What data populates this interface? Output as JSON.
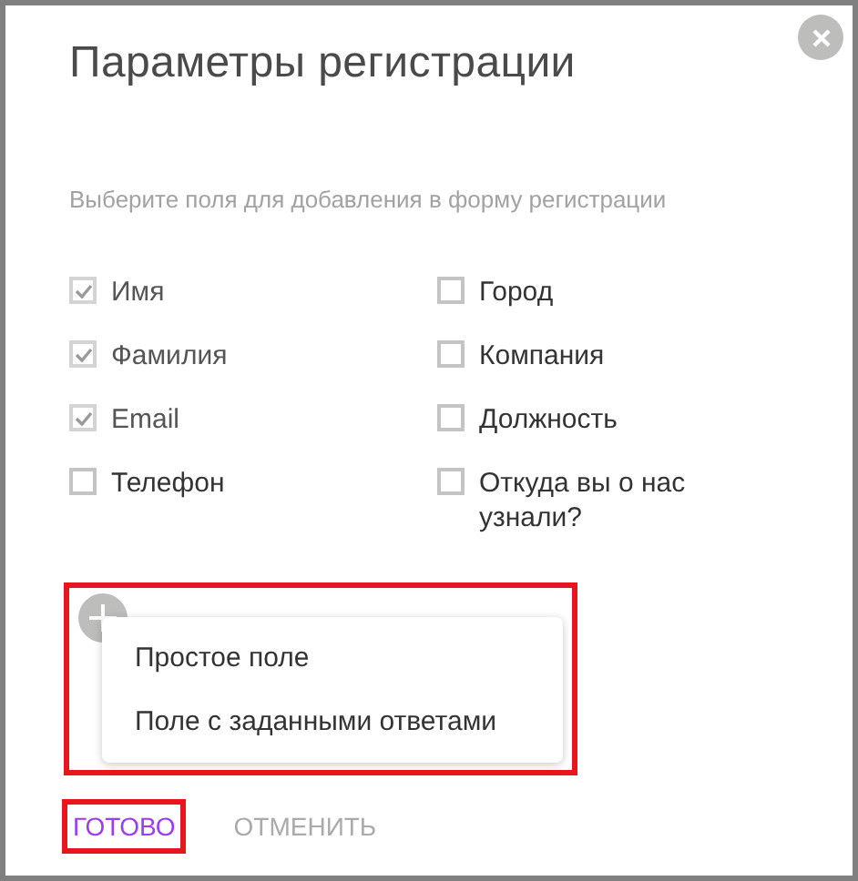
{
  "dialog": {
    "title": "Параметры регистрации",
    "subtitle": "Выберите поля для добавления в форму регистрации"
  },
  "fields": [
    {
      "label": "Имя",
      "checked": true,
      "disabled": true
    },
    {
      "label": "Фамилия",
      "checked": true,
      "disabled": true
    },
    {
      "label": "Email",
      "checked": true,
      "disabled": true
    },
    {
      "label": "Телефон",
      "checked": false,
      "disabled": false
    },
    {
      "label": "Город",
      "checked": false,
      "disabled": false
    },
    {
      "label": "Компания",
      "checked": false,
      "disabled": false
    },
    {
      "label": "Должность",
      "checked": false,
      "disabled": false
    },
    {
      "label": "Откуда вы о нас узнали?",
      "checked": false,
      "disabled": false
    }
  ],
  "add_menu": {
    "highlighted": true,
    "items": [
      "Простое поле",
      "Поле с заданными ответами"
    ]
  },
  "buttons": [
    {
      "label": "ГОТОВО",
      "kind": "primary",
      "highlighted": true
    },
    {
      "label": "ОТМЕНИТЬ",
      "kind": "secondary",
      "highlighted": false
    }
  ]
}
